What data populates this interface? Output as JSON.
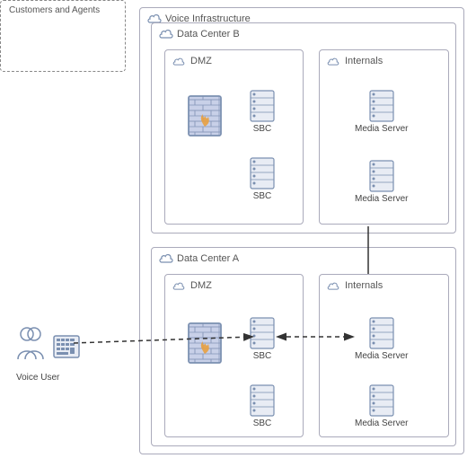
{
  "diagram": {
    "title": "Voice Infrastructure",
    "dc_b_label": "Data Center B",
    "dc_a_label": "Data Center A",
    "dmz_label": "DMZ",
    "internals_label": "Internals",
    "customers_label": "Customers and Agents",
    "voice_user_label": "Voice User",
    "sbc_label": "SBC",
    "media_server_label": "Media Server",
    "icons": {
      "cloud": "☁",
      "server": "server",
      "firewall": "firewall",
      "person": "👤",
      "phone": "☎"
    }
  }
}
